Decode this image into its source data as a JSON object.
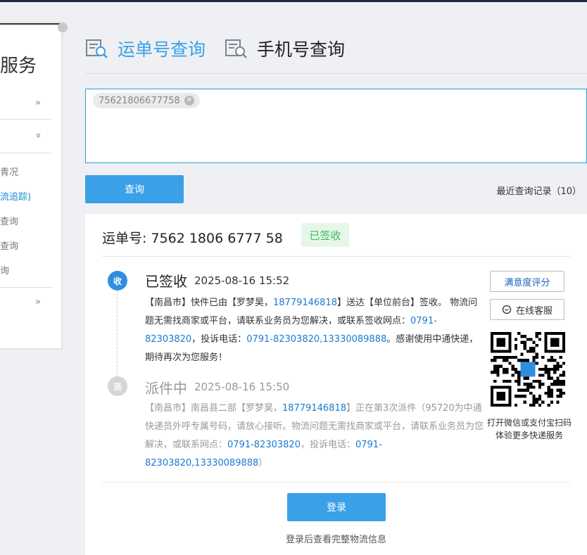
{
  "sidebar": {
    "title": "服务",
    "rows": [
      {
        "label": "青况",
        "active": false
      },
      {
        "label": "流追踪)",
        "active": true
      },
      {
        "label": "查询",
        "active": false
      },
      {
        "label": "查询",
        "active": false
      },
      {
        "label": "询",
        "active": false
      }
    ],
    "chevron_right": "»",
    "chevron_down": "»"
  },
  "tabs": [
    {
      "label": "运单号查询",
      "icon": "waybill-search-icon",
      "active": true
    },
    {
      "label": "手机号查询",
      "icon": "phone-search-icon",
      "active": false
    }
  ],
  "search": {
    "chip_value": "75621806677758"
  },
  "actions": {
    "query_label": "查询",
    "recent_label": "最近查询记录（10）"
  },
  "result": {
    "waybill_label": "运单号: 7562 1806 6777 58",
    "status_badge": "已签收",
    "events": [
      {
        "node": "收",
        "status": "已签收",
        "time": "2025-08-16 15:52",
        "text_parts": [
          "【南昌市】快件已由【罗梦昊，",
          "18779146818",
          "】送达【单位前台】签收。 物流问题无需找商家或平台，请联系业务员为您解决，或联系签收网点：",
          "0791-82303820",
          "，投诉电话：",
          "0791-82303820,13330089888",
          "。感谢使用中通快递，期待再次为您服务！"
        ]
      },
      {
        "node": "派",
        "status": "派件中",
        "time": "2025-08-16 15:50",
        "text_parts": [
          "【南昌市】南昌县二部【罗梦昊，",
          "18779146818",
          "】正在第3次派件（95720为中通快递员外呼专属号码，请放心接听。物流问题无需找商家或平台，请联系业务员为您解决，或联系网点：",
          "0791-82303820",
          "，投诉电话：",
          "0791-82303820,13330089888",
          "）"
        ]
      }
    ],
    "rate_label": "满意度评分",
    "service_label": "在线客服",
    "qr_caption_1": "打开微信或支付宝扫码",
    "qr_caption_2": "体验更多快递服务",
    "login_label": "登录",
    "login_hint": "登录后查看完整物流信息"
  },
  "colors": {
    "accent": "#3aa0e8",
    "link": "#1a7ad0",
    "signed_green": "#3cba5a"
  }
}
